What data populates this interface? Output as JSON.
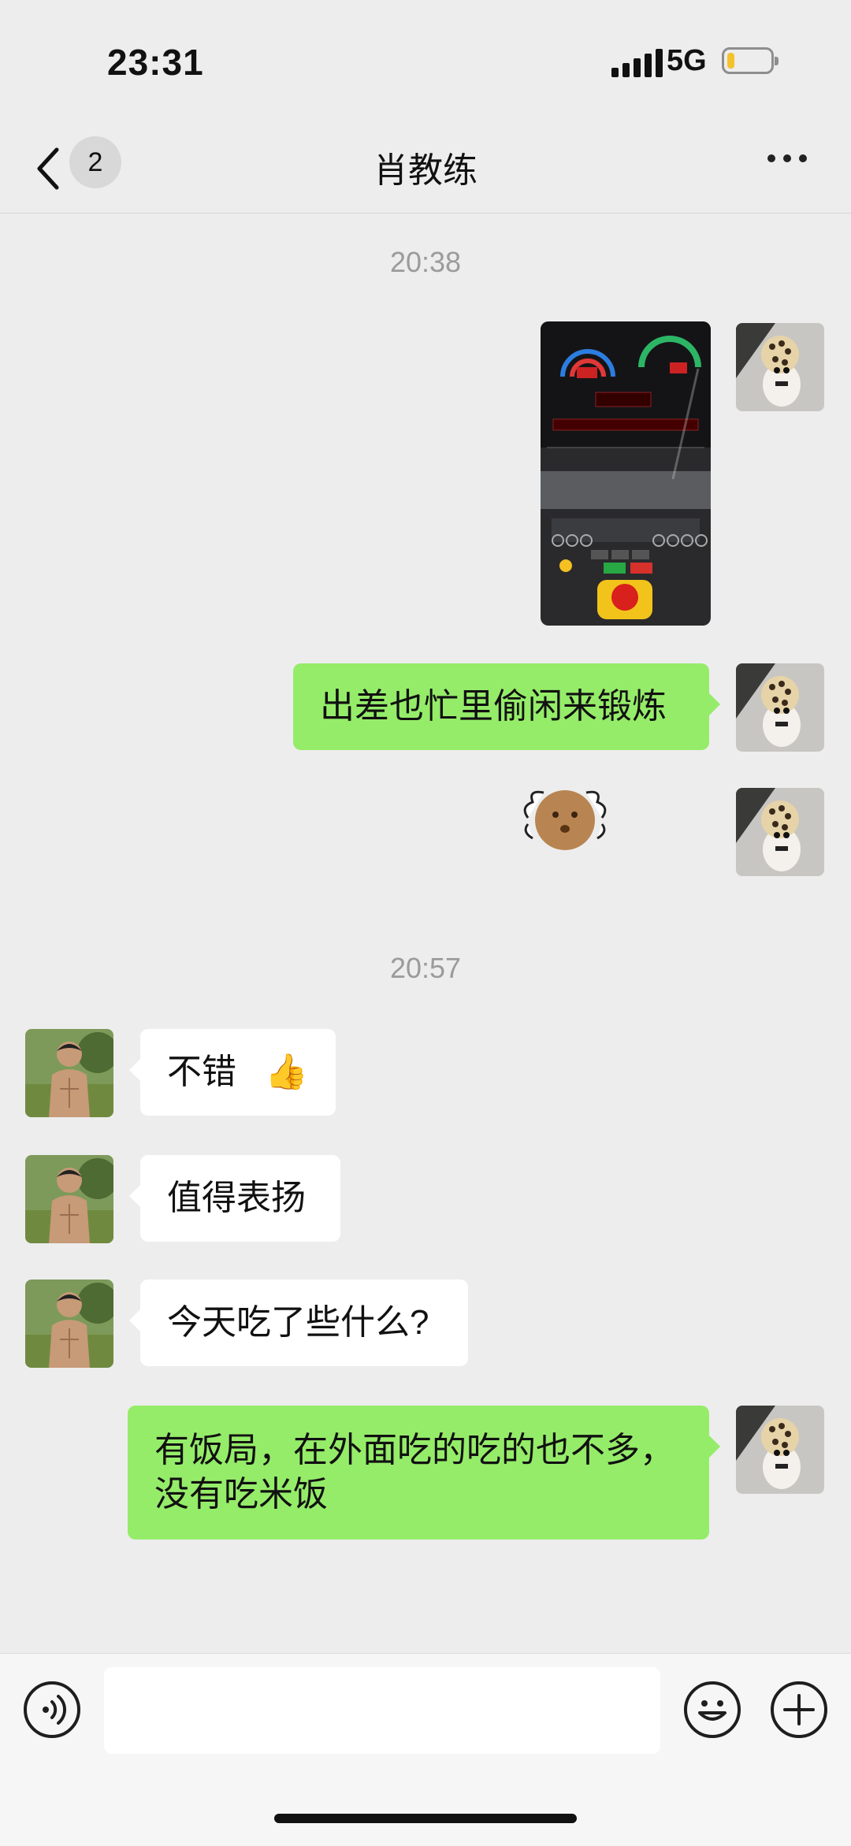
{
  "status_bar": {
    "time": "23:31",
    "network": "5G",
    "battery_level": 0.18
  },
  "header": {
    "back_count": "2",
    "title": "肖教练",
    "more_icon": "more-dots-icon"
  },
  "messages": {
    "ts1": "20:38",
    "m_image": {
      "from": "me",
      "kind": "image",
      "alt": "treadmill console photo"
    },
    "m1": {
      "from": "me",
      "text": "出差也忙里偷闲来锻炼"
    },
    "m_sticker": {
      "from": "me",
      "kind": "sticker",
      "alt": "round potato sticker"
    },
    "ts2": "20:57",
    "m2": {
      "from": "coach",
      "text": "不错",
      "emoji": "👍"
    },
    "m3": {
      "from": "coach",
      "text": "值得表扬"
    },
    "m4": {
      "from": "coach",
      "text": "今天吃了些什么?"
    },
    "m5": {
      "from": "me",
      "text": "有饭局，在外面吃的吃的也不多，没有吃米饭"
    }
  },
  "input_bar": {
    "text": "",
    "voice_icon": "voice-icon",
    "emoji_icon": "emoji-icon",
    "plus_icon": "plus-icon"
  },
  "colors": {
    "background": "#ededed",
    "out_bubble": "#95ec69",
    "in_bubble": "#ffffff",
    "battery": "#f4c22d"
  }
}
